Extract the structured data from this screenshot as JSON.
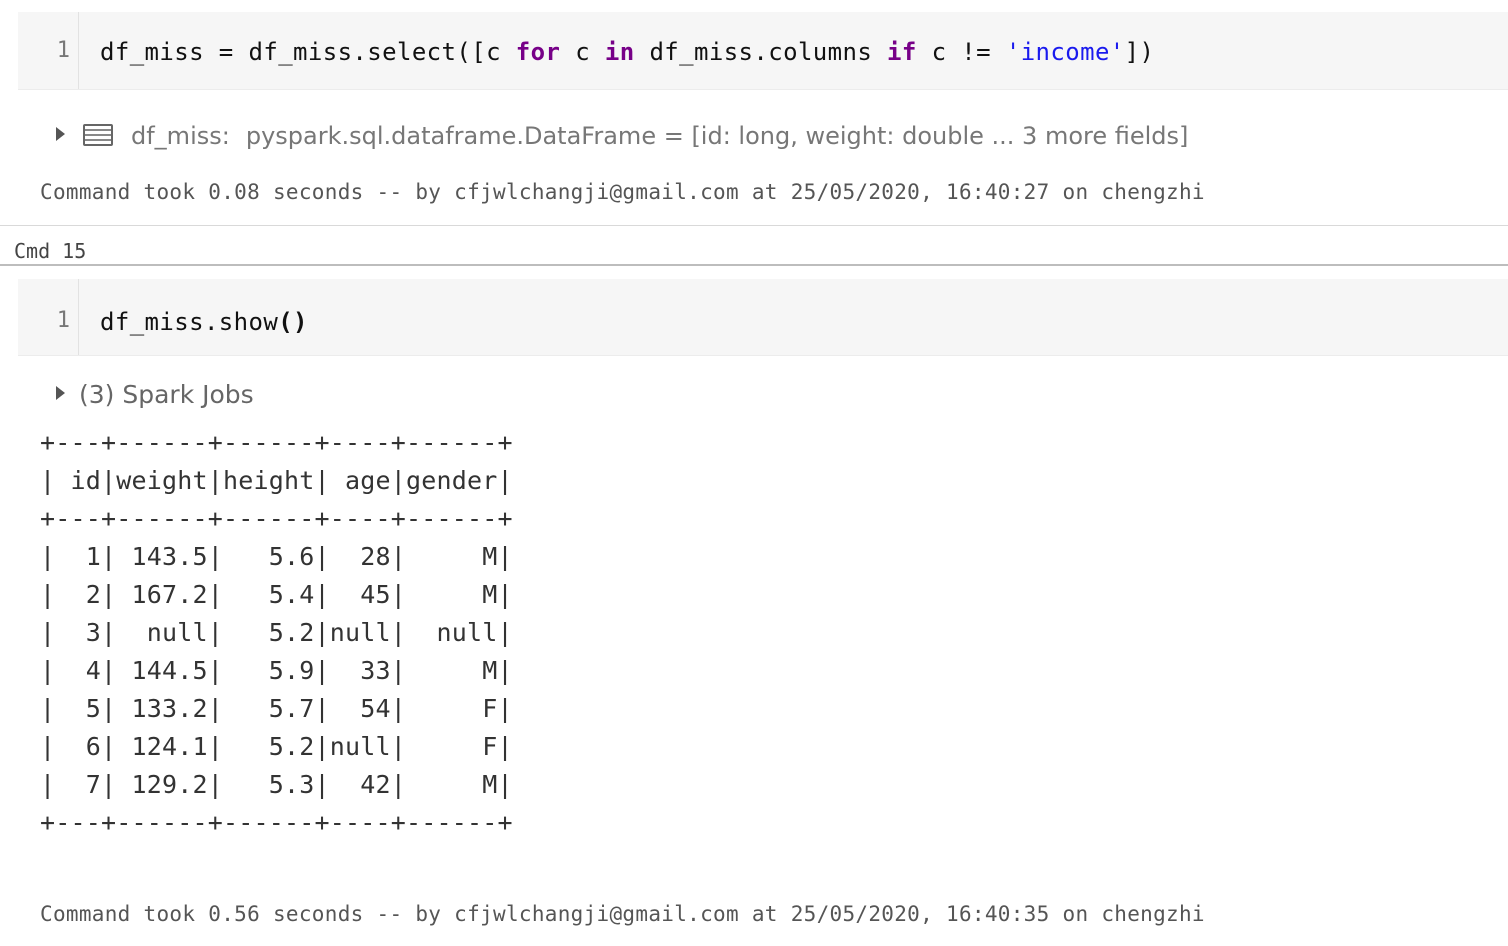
{
  "cell1": {
    "line_number": "1",
    "code_tokens": [
      {
        "t": "df_miss = df_miss.select([c ",
        "c": ""
      },
      {
        "t": "for",
        "c": "kw"
      },
      {
        "t": " c ",
        "c": ""
      },
      {
        "t": "in",
        "c": "kw"
      },
      {
        "t": " df_miss.columns ",
        "c": ""
      },
      {
        "t": "if",
        "c": "kw"
      },
      {
        "t": " c != ",
        "c": ""
      },
      {
        "t": "'income'",
        "c": "str"
      },
      {
        "t": "])",
        "c": ""
      }
    ],
    "output_name": "df_miss:",
    "output_type": "pyspark.sql.dataframe.DataFrame = [id: long, weight: double ... 3 more fields]",
    "command_took": "Command took 0.08 seconds -- by cfjwlchangji@gmail.com at 25/05/2020, 16:40:27 on chengzhi"
  },
  "cmd_label": "Cmd 15",
  "cell2": {
    "line_number": "1",
    "code_prefix": "df_miss.show",
    "code_parens": "()",
    "spark_jobs": "(3) Spark Jobs",
    "table_border": "+---+------+------+----+------+",
    "table_header": "| id|weight|height| age|gender|",
    "table_rows": [
      "|  1| 143.5|   5.6|  28|     M|",
      "|  2| 167.2|   5.4|  45|     M|",
      "|  3|  null|   5.2|null|  null|",
      "|  4| 144.5|   5.9|  33|     M|",
      "|  5| 133.2|   5.7|  54|     F|",
      "|  6| 124.1|   5.2|null|     F|",
      "|  7| 129.2|   5.3|  42|     M|"
    ],
    "command_took": "Command took 0.56 seconds -- by cfjwlchangji@gmail.com at 25/05/2020, 16:40:35 on chengzhi"
  },
  "icons": {
    "expand": "triangle-right-icon",
    "dataframe": "dataframe-table-icon"
  }
}
